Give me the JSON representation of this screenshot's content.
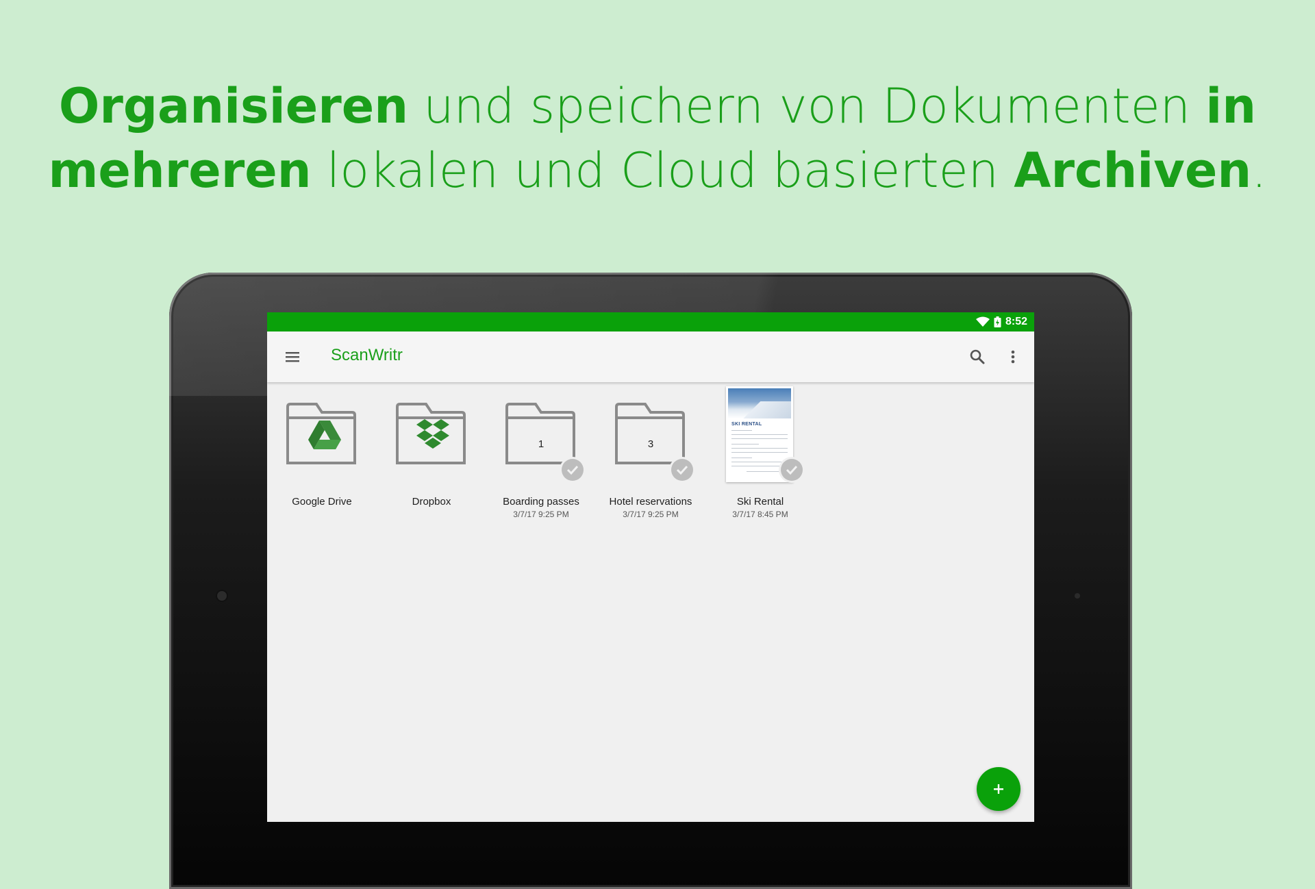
{
  "headline": {
    "line1": [
      {
        "text": "Organisieren",
        "bold": true
      },
      {
        "text": " und speichern von Dokumenten ",
        "bold": false
      },
      {
        "text": "in",
        "bold": true
      }
    ],
    "line2": [
      {
        "text": "mehreren",
        "bold": true
      },
      {
        "text": " lokalen und Cloud basierten ",
        "bold": false
      },
      {
        "text": "Archiven",
        "bold": true
      },
      {
        "text": ".",
        "bold": false
      }
    ]
  },
  "colors": {
    "background": "#cdedd0",
    "accent": "#0aa10a",
    "headline": "#1a9f1a",
    "toolbar": "#f5f5f5",
    "content": "#f0f0f0"
  },
  "status_bar": {
    "time": "8:52",
    "icons": [
      "wifi-icon",
      "battery-charging-icon"
    ]
  },
  "toolbar": {
    "app_title": "ScanWritr",
    "menu_icon": "hamburger-menu-icon",
    "search_icon": "search-icon",
    "more_icon": "more-vert-icon"
  },
  "items": [
    {
      "name": "Google Drive",
      "icon": "google-drive-icon",
      "type": "cloud-folder"
    },
    {
      "name": "Dropbox",
      "icon": "dropbox-icon",
      "type": "cloud-folder"
    },
    {
      "name": "Boarding passes",
      "count": "1",
      "date": "3/7/17 9:25 PM",
      "type": "folder"
    },
    {
      "name": "Hotel reservations",
      "count": "3",
      "date": "3/7/17 9:25 PM",
      "type": "folder"
    },
    {
      "name": "Ski Rental",
      "date": "3/7/17 8:45 PM",
      "type": "document",
      "doc_heading": "SKI RENTAL"
    }
  ],
  "fab": {
    "icon": "plus-icon"
  }
}
